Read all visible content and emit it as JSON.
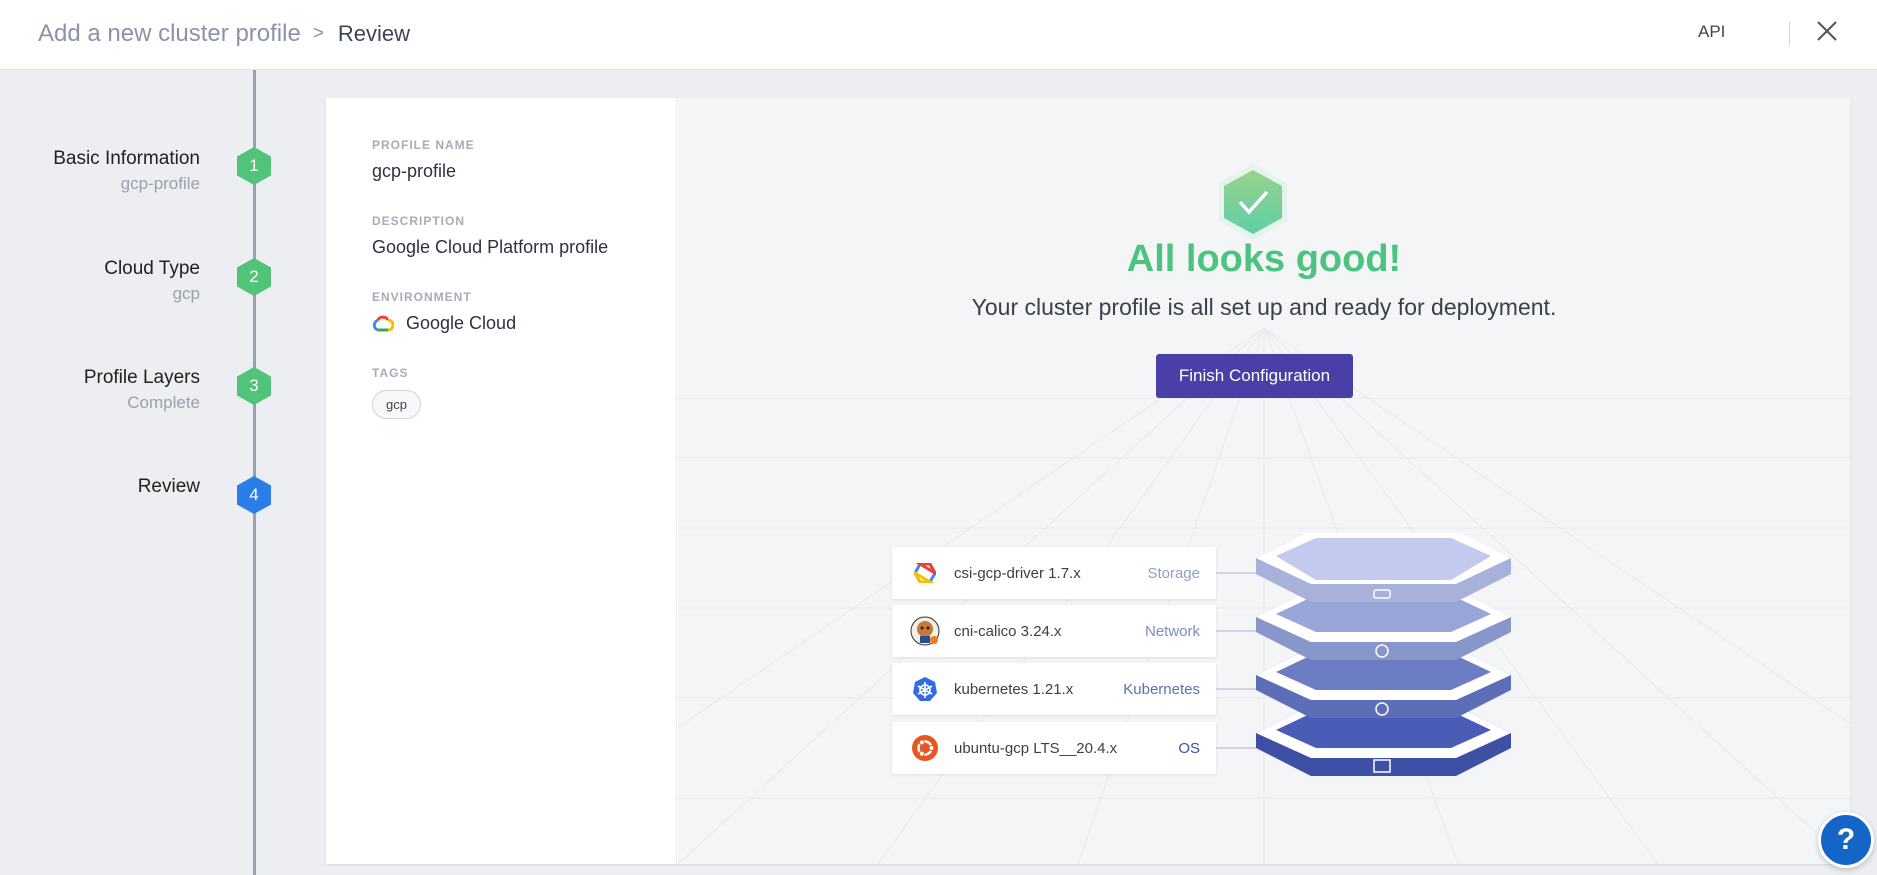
{
  "header": {
    "breadcrumb_root": "Add a new cluster profile",
    "breadcrumb_separator": ">",
    "breadcrumb_current": "Review",
    "api_label": "API",
    "close_icon": "close-icon"
  },
  "steps": [
    {
      "title": "Basic Information",
      "subtitle": "gcp-profile",
      "number": "1",
      "state": "done"
    },
    {
      "title": "Cloud Type",
      "subtitle": "gcp",
      "number": "2",
      "state": "done"
    },
    {
      "title": "Profile Layers",
      "subtitle": "Complete",
      "number": "3",
      "state": "done"
    },
    {
      "title": "Review",
      "subtitle": "",
      "number": "4",
      "state": "active"
    }
  ],
  "details": {
    "profile_name_label": "PROFILE NAME",
    "profile_name": "gcp-profile",
    "description_label": "DESCRIPTION",
    "description": "Google Cloud Platform profile",
    "environment_label": "ENVIRONMENT",
    "environment": "Google Cloud",
    "environment_icon": "google-cloud-icon",
    "tags_label": "TAGS",
    "tags": [
      "gcp"
    ]
  },
  "review": {
    "title": "All looks good!",
    "subtitle": "Your cluster profile is all set up and ready for deployment.",
    "finish_button": "Finish Configuration",
    "layers": [
      {
        "name": "csi-gcp-driver 1.7.x",
        "type": "Storage",
        "icon": "gcp-driver-icon",
        "type_color": "#8fa0c8"
      },
      {
        "name": "cni-calico 3.24.x",
        "type": "Network",
        "icon": "calico-icon",
        "type_color": "#7d8dc0"
      },
      {
        "name": "kubernetes 1.21.x",
        "type": "Kubernetes",
        "icon": "kubernetes-icon",
        "type_color": "#5c6fb7"
      },
      {
        "name": "ubuntu-gcp LTS__20.4.x",
        "type": "OS",
        "icon": "ubuntu-icon",
        "type_color": "#3f4fa3"
      }
    ]
  },
  "help_button": "?",
  "colors": {
    "success": "#4cc37e",
    "primary": "#4a3fa6",
    "step_done": "#52c47a",
    "step_active": "#2b7de9"
  }
}
